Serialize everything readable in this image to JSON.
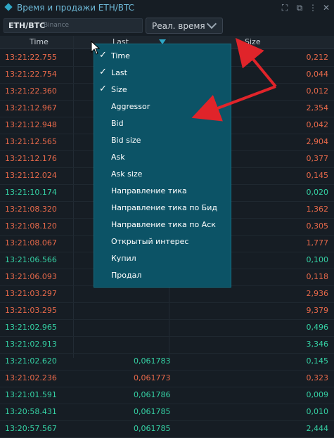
{
  "window": {
    "title": "Время и продажи ETH/BTC",
    "buttons": [
      "fullscreen-icon",
      "link-icon",
      "settings-icon",
      "close-icon"
    ]
  },
  "toolbar": {
    "symbol": "ETH/BTC",
    "exchange": "Binance",
    "mode": "Реал. время"
  },
  "table": {
    "headers": [
      "Time",
      "Last",
      "Size"
    ],
    "rows": [
      {
        "time": "13:21:22.755",
        "last": "",
        "size": "0,212",
        "side": "sell"
      },
      {
        "time": "13:21:22.754",
        "last": "",
        "size": "0,044",
        "side": "sell"
      },
      {
        "time": "13:21:22.360",
        "last": "",
        "size": "0,012",
        "side": "sell"
      },
      {
        "time": "13:21:12.967",
        "last": "",
        "size": "2,354",
        "side": "sell"
      },
      {
        "time": "13:21:12.948",
        "last": "",
        "size": "0,042",
        "side": "sell"
      },
      {
        "time": "13:21:12.565",
        "last": "",
        "size": "2,904",
        "side": "sell"
      },
      {
        "time": "13:21:12.176",
        "last": "",
        "size": "0,377",
        "side": "sell"
      },
      {
        "time": "13:21:12.024",
        "last": "",
        "size": "0,145",
        "side": "sell"
      },
      {
        "time": "13:21:10.174",
        "last": "",
        "size": "0,020",
        "side": "buy"
      },
      {
        "time": "13:21:08.320",
        "last": "",
        "size": "1,362",
        "side": "sell"
      },
      {
        "time": "13:21:08.120",
        "last": "",
        "size": "0,305",
        "side": "sell"
      },
      {
        "time": "13:21:08.067",
        "last": "",
        "size": "1,777",
        "side": "sell"
      },
      {
        "time": "13:21:06.566",
        "last": "",
        "size": "0,100",
        "side": "buy"
      },
      {
        "time": "13:21:06.093",
        "last": "",
        "size": "0,118",
        "side": "sell"
      },
      {
        "time": "13:21:03.297",
        "last": "",
        "size": "2,936",
        "side": "sell"
      },
      {
        "time": "13:21:03.295",
        "last": "",
        "size": "9,379",
        "side": "sell"
      },
      {
        "time": "13:21:02.965",
        "last": "",
        "size": "0,496",
        "side": "buy"
      },
      {
        "time": "13:21:02.913",
        "last": "",
        "size": "3,346",
        "side": "buy"
      },
      {
        "time": "13:21:02.620",
        "last": "0,061783",
        "size": "0,145",
        "side": "buy"
      },
      {
        "time": "13:21:02.236",
        "last": "0,061773",
        "size": "0,323",
        "side": "sell"
      },
      {
        "time": "13:21:01.591",
        "last": "0,061786",
        "size": "0,009",
        "side": "buy"
      },
      {
        "time": "13:20:58.431",
        "last": "0,061785",
        "size": "0,010",
        "side": "buy"
      },
      {
        "time": "13:20:57.567",
        "last": "0,061785",
        "size": "2,444",
        "side": "buy"
      }
    ]
  },
  "menu": {
    "items": [
      {
        "label": "Time",
        "checked": "✓"
      },
      {
        "label": "Last",
        "checked": "✓"
      },
      {
        "label": "Size",
        "checked": "✓"
      },
      {
        "label": "Aggressor",
        "checked": ""
      },
      {
        "label": "Bid",
        "checked": ""
      },
      {
        "label": "Bid size",
        "checked": ""
      },
      {
        "label": "Ask",
        "checked": ""
      },
      {
        "label": "Ask size",
        "checked": ""
      },
      {
        "label": "Направление тика",
        "checked": ""
      },
      {
        "label": "Направление тика по Бид",
        "checked": ""
      },
      {
        "label": "Направление тика по Аск",
        "checked": ""
      },
      {
        "label": "Открытый интерес",
        "checked": ""
      },
      {
        "label": "Купил",
        "checked": ""
      },
      {
        "label": "Продал",
        "checked": ""
      }
    ]
  },
  "colors": {
    "sell": "#e8694a",
    "buy": "#35d1a4",
    "menu_bg": "#0c5366",
    "accent": "#2fa7c6",
    "annotation_arrow": "#e0242a"
  }
}
